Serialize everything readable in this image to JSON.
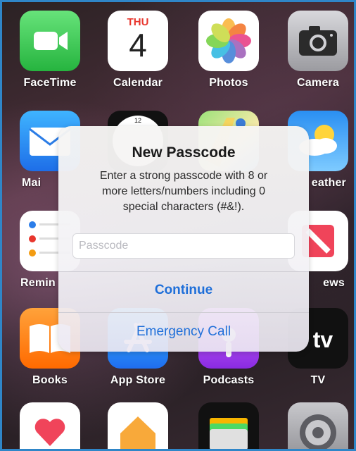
{
  "apps": {
    "facetime": "FaceTime",
    "calendar": "Calendar",
    "calendar_day": "THU",
    "calendar_date": "4",
    "photos": "Photos",
    "camera": "Camera",
    "mail_partial": "Mai",
    "weather_partial": "eather",
    "reminders_partial": "Remin",
    "news_partial": "ews",
    "books": "Books",
    "app_store": "App Store",
    "podcasts": "Podcasts",
    "tv": "TV",
    "tv_logo": "tv",
    "clock_tick": "12"
  },
  "dialog": {
    "title": "New Passcode",
    "message_line1": "Enter a strong passcode with 8 or",
    "message_line2": "more letters/numbers including 0",
    "message_line3": "special characters (#&!).",
    "passcode_placeholder": "Passcode",
    "passcode_value": "",
    "continue_label": "Continue",
    "emergency_label": "Emergency Call"
  },
  "colors": {
    "frame_border": "#2f86c8",
    "button_blue": "#1f6fd9",
    "calendar_red": "#e8362d"
  }
}
